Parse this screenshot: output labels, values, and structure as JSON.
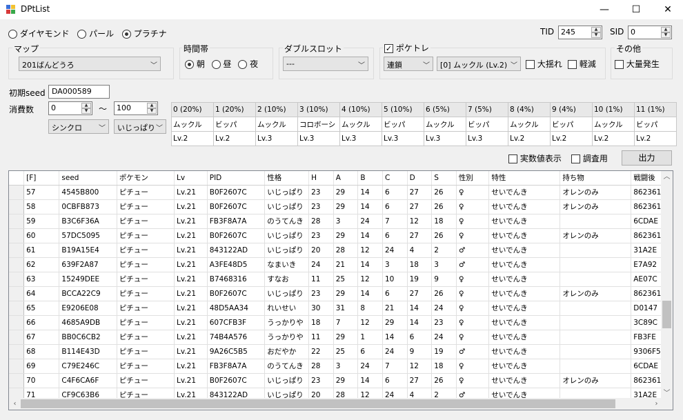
{
  "window": {
    "title": "DPtList",
    "minimize": "—",
    "maximize": "☐",
    "close": "✕"
  },
  "version": {
    "options": [
      {
        "label": "ダイヤモンド",
        "selected": false
      },
      {
        "label": "パール",
        "selected": false
      },
      {
        "label": "プラチナ",
        "selected": true
      }
    ]
  },
  "tid": {
    "label": "TID",
    "value": "245"
  },
  "sid": {
    "label": "SID",
    "value": "0"
  },
  "map": {
    "title": "マップ",
    "value": "201ばんどうろ"
  },
  "timezone": {
    "title": "時間帯",
    "options": [
      {
        "label": "朝",
        "selected": true
      },
      {
        "label": "昼",
        "selected": false
      },
      {
        "label": "夜",
        "selected": false
      }
    ]
  },
  "dualslot": {
    "title": "ダブルスロット",
    "value": "---"
  },
  "pokeradar": {
    "title": "ポケトレ",
    "checked": true,
    "mode": "連鎖",
    "target": "[0] ムックル (Lv.2)",
    "big_shake": {
      "label": "大揺れ",
      "checked": false
    },
    "light": {
      "label": "軽減",
      "checked": false
    }
  },
  "other": {
    "title": "その他",
    "swarm": {
      "label": "大量発生",
      "checked": false
    }
  },
  "seed": {
    "label": "初期seed",
    "value": "DA000589"
  },
  "consumption": {
    "label": "消費数",
    "min": "0",
    "tilde": "〜",
    "max": "100"
  },
  "lead": {
    "value": "シンクロ"
  },
  "nature": {
    "value": "いじっぱり"
  },
  "slot_headers": [
    "0 (20%)",
    "1 (20%)",
    "2 (10%)",
    "3 (10%)",
    "4 (10%)",
    "5 (10%)",
    "6 (5%)",
    "7 (5%)",
    "8 (4%)",
    "9 (4%)",
    "10 (1%)",
    "11 (1%)"
  ],
  "slot_pokemon": [
    "ムックル",
    "ビッパ",
    "ムックル",
    "コロボーシ",
    "ムックル",
    "ビッパ",
    "ムックル",
    "ビッパ",
    "ムックル",
    "ビッパ",
    "ムックル",
    "ビッパ"
  ],
  "slot_levels": [
    "Lv.2",
    "Lv.2",
    "Lv.3",
    "Lv.3",
    "Lv.3",
    "Lv.3",
    "Lv.3",
    "Lv.3",
    "Lv.2",
    "Lv.2",
    "Lv.2",
    "Lv.2"
  ],
  "options": {
    "real_stats": {
      "label": "実数値表示",
      "checked": false
    },
    "research": {
      "label": "調査用",
      "checked": false
    },
    "output_button": "出力"
  },
  "table": {
    "columns": [
      "[F]",
      "seed",
      "ポケモン",
      "Lv",
      "PID",
      "性格",
      "H",
      "A",
      "B",
      "C",
      "D",
      "S",
      "性別",
      "特性",
      "持ち物",
      "戦闘後"
    ],
    "rows": [
      [
        "57",
        "4545B800",
        "ピチュー",
        "Lv.21",
        "B0F2607C",
        "いじっぱり",
        "23",
        "29",
        "14",
        "6",
        "27",
        "26",
        "♀",
        "せいでんき",
        "オレンのみ",
        "862361"
      ],
      [
        "58",
        "0CBFB873",
        "ピチュー",
        "Lv.21",
        "B0F2607C",
        "いじっぱり",
        "23",
        "29",
        "14",
        "6",
        "27",
        "26",
        "♀",
        "せいでんき",
        "オレンのみ",
        "862361"
      ],
      [
        "59",
        "B3C6F36A",
        "ピチュー",
        "Lv.21",
        "FB3F8A7A",
        "のうてんき",
        "28",
        "3",
        "24",
        "7",
        "12",
        "18",
        "♀",
        "せいでんき",
        "",
        "6CDAE"
      ],
      [
        "60",
        "57DC5095",
        "ピチュー",
        "Lv.21",
        "B0F2607C",
        "いじっぱり",
        "23",
        "29",
        "14",
        "6",
        "27",
        "26",
        "♀",
        "せいでんき",
        "オレンのみ",
        "862361"
      ],
      [
        "61",
        "B19A15E4",
        "ピチュー",
        "Lv.21",
        "843122AD",
        "いじっぱり",
        "20",
        "28",
        "12",
        "24",
        "4",
        "2",
        "♂",
        "せいでんき",
        "",
        "31A2E"
      ],
      [
        "62",
        "639F2A87",
        "ピチュー",
        "Lv.21",
        "A3FE48D5",
        "なまいき",
        "24",
        "21",
        "14",
        "3",
        "18",
        "3",
        "♂",
        "せいでんき",
        "",
        "E7A92"
      ],
      [
        "63",
        "15249DEE",
        "ピチュー",
        "Lv.21",
        "B7468316",
        "すなお",
        "11",
        "25",
        "12",
        "10",
        "19",
        "9",
        "♀",
        "せいでんき",
        "",
        "AE07C"
      ],
      [
        "64",
        "BCCA22C9",
        "ピチュー",
        "Lv.21",
        "B0F2607C",
        "いじっぱり",
        "23",
        "29",
        "14",
        "6",
        "27",
        "26",
        "♀",
        "せいでんき",
        "オレンのみ",
        "862361"
      ],
      [
        "65",
        "E9206E08",
        "ピチュー",
        "Lv.21",
        "48D5AA34",
        "れいせい",
        "30",
        "31",
        "8",
        "21",
        "14",
        "24",
        "♀",
        "せいでんき",
        "",
        "D0147"
      ],
      [
        "66",
        "4685A9DB",
        "ピチュー",
        "Lv.21",
        "607CFB3F",
        "うっかりや",
        "18",
        "7",
        "12",
        "29",
        "14",
        "23",
        "♀",
        "せいでんき",
        "",
        "3C89C"
      ],
      [
        "67",
        "BB0C6CB2",
        "ピチュー",
        "Lv.21",
        "74B4A576",
        "うっかりや",
        "11",
        "29",
        "1",
        "14",
        "6",
        "24",
        "♀",
        "せいでんき",
        "",
        "FB3FE"
      ],
      [
        "68",
        "B114E43D",
        "ピチュー",
        "Lv.21",
        "9A26C5B5",
        "おだやか",
        "22",
        "25",
        "6",
        "24",
        "9",
        "19",
        "♂",
        "せいでんき",
        "",
        "9306F5"
      ],
      [
        "69",
        "C79E246C",
        "ピチュー",
        "Lv.21",
        "FB3F8A7A",
        "のうてんき",
        "28",
        "3",
        "24",
        "7",
        "12",
        "18",
        "♀",
        "せいでんき",
        "",
        "6CDAE"
      ],
      [
        "70",
        "C4F6CA6F",
        "ピチュー",
        "Lv.21",
        "B0F2607C",
        "いじっぱり",
        "23",
        "29",
        "14",
        "6",
        "27",
        "26",
        "♀",
        "せいでんき",
        "オレンのみ",
        "862361"
      ],
      [
        "71",
        "CF9C63B6",
        "ピチュー",
        "Lv.21",
        "843122AD",
        "いじっぱり",
        "20",
        "28",
        "12",
        "24",
        "4",
        "2",
        "♂",
        "せいでんき",
        "",
        "31A2E"
      ]
    ]
  }
}
